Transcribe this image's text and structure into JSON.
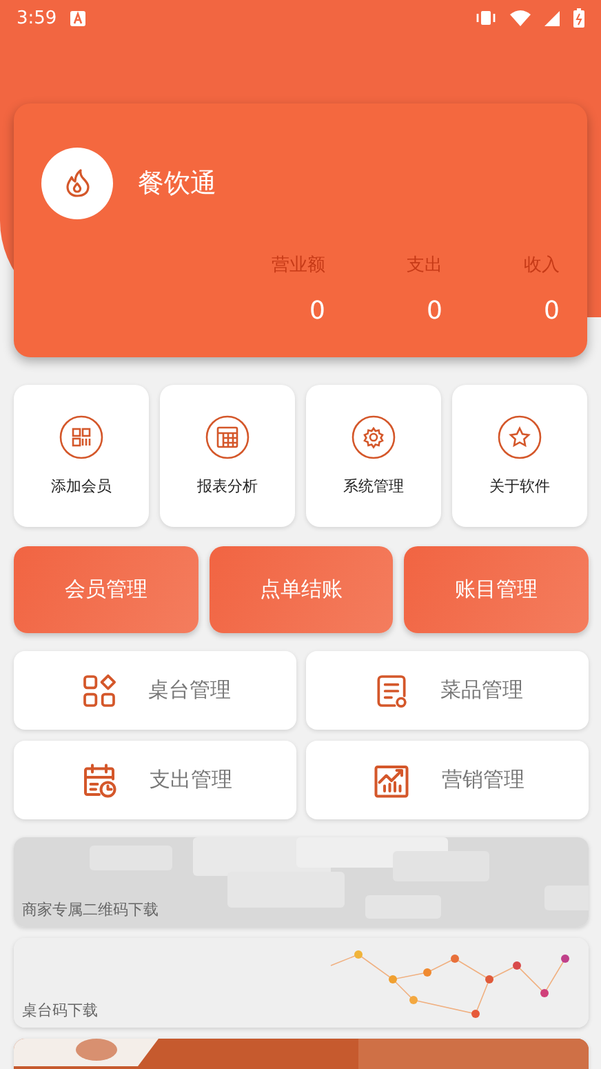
{
  "status_bar": {
    "time": "3:59"
  },
  "header": {
    "app_name": "餐饮通",
    "stats": [
      {
        "label": "营业额",
        "value": "0"
      },
      {
        "label": "支出",
        "value": "0"
      },
      {
        "label": "收入",
        "value": "0"
      }
    ]
  },
  "shortcuts": [
    {
      "label": "添加会员"
    },
    {
      "label": "报表分析"
    },
    {
      "label": "系统管理"
    },
    {
      "label": "关于软件"
    }
  ],
  "actions": [
    {
      "label": "会员管理"
    },
    {
      "label": "点单结账"
    },
    {
      "label": "账目管理"
    }
  ],
  "modules": [
    {
      "label": "桌台管理"
    },
    {
      "label": "菜品管理"
    },
    {
      "label": "支出管理"
    },
    {
      "label": "营销管理"
    }
  ],
  "banners": [
    {
      "kind": "captioned",
      "caption": "商家专属二维码下载"
    },
    {
      "kind": "captioned",
      "caption": "桌台码下载"
    },
    {
      "kind": "picture"
    }
  ]
}
